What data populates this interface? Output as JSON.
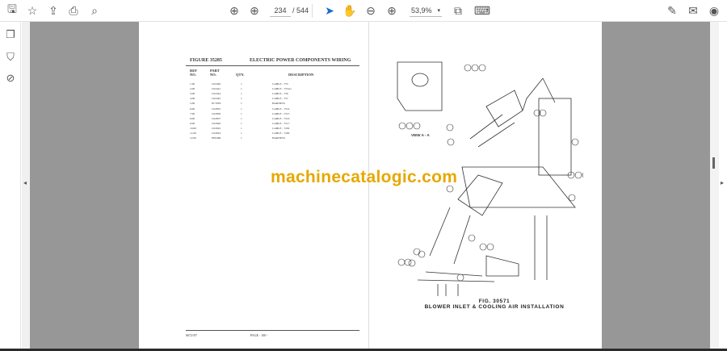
{
  "toolbar": {
    "page_current": "234",
    "page_total": "/ 544",
    "zoom": "53,9%"
  },
  "document": {
    "left_page": {
      "figure": "FIGURE 35285",
      "title": "ELECTRIC POWER COMPONENTS WIRING",
      "headers": {
        "ref": "REF NO.",
        "part": "PART NO.",
        "qty": "QTY.",
        "desc": "DESCRIPTION"
      },
      "rows": [
        {
          "ref": "1.00",
          "part": "C02440",
          "qty": "1",
          "desc": "CABLE - 755"
        },
        {
          "ref": "2.00",
          "part": "C02441",
          "qty": "1",
          "desc": "CABLE - 755A1"
        },
        {
          "ref": "3.00",
          "part": "C02444",
          "qty": "1",
          "desc": "CABLE - 756"
        },
        {
          "ref": "4.00",
          "part": "C02445",
          "qty": "1",
          "desc": "CABLE - 757"
        },
        {
          "ref": "5.00",
          "part": "EC7885",
          "qty": "1",
          "desc": "HARNESS"
        },
        {
          "ref": "6.00",
          "part": "C02855",
          "qty": "1",
          "desc": "CABLE - 7514"
        },
        {
          "ref": "7.00",
          "part": "C02856",
          "qty": "1",
          "desc": "CABLE - 7515"
        },
        {
          "ref": "8.00",
          "part": "C02857",
          "qty": "1",
          "desc": "CABLE - 7516"
        },
        {
          "ref": "9.00",
          "part": "C02920",
          "qty": "1",
          "desc": "CABLE - 7517"
        },
        {
          "ref": "10.00",
          "part": "C02922",
          "qty": "1",
          "desc": "CABLE - 7202"
        },
        {
          "ref": "11.00",
          "part": "C02924",
          "qty": "1",
          "desc": "CABLE - 7200"
        },
        {
          "ref": "12.00",
          "part": "EE0469",
          "qty": "1",
          "desc": "HARNESS"
        }
      ],
      "footer_left": "0672197",
      "footer_page": "PAGE : 100 -"
    },
    "right_page": {
      "view_label": "VIEW A - A",
      "fig": "FIG. 30571",
      "caption": "BLOWER INLET & COOLING AIR INSTALLATION"
    },
    "watermark": "machinecatalogic.com"
  }
}
